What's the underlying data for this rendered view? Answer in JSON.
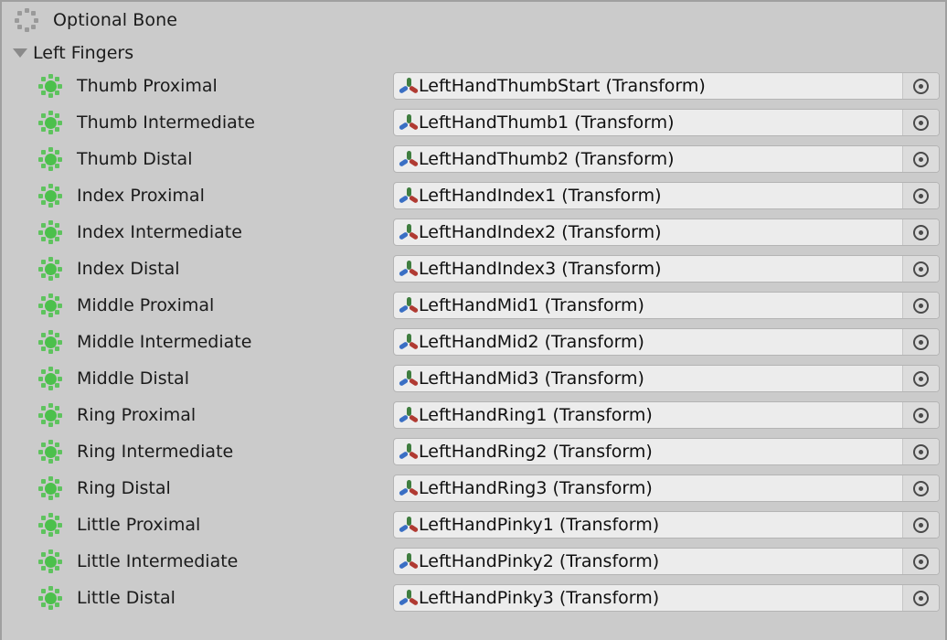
{
  "panel": {
    "legend": {
      "icon": "optional-bone-icon",
      "label": "Optional Bone"
    },
    "group": {
      "icon": "chevron-down-icon",
      "label": "Left Fingers",
      "expanded": true
    },
    "field_icon": "transform-gizmo-icon",
    "picker_icon": "object-picker-icon",
    "bone_icon": "assigned-bone-icon",
    "rows": [
      {
        "label": "Thumb Proximal",
        "value": "LeftHandThumbStart (Transform)"
      },
      {
        "label": "Thumb Intermediate",
        "value": "LeftHandThumb1 (Transform)"
      },
      {
        "label": "Thumb Distal",
        "value": "LeftHandThumb2 (Transform)"
      },
      {
        "label": "Index Proximal",
        "value": "LeftHandIndex1 (Transform)"
      },
      {
        "label": "Index Intermediate",
        "value": "LeftHandIndex2 (Transform)"
      },
      {
        "label": "Index Distal",
        "value": "LeftHandIndex3 (Transform)"
      },
      {
        "label": "Middle Proximal",
        "value": "LeftHandMid1 (Transform)"
      },
      {
        "label": "Middle Intermediate",
        "value": "LeftHandMid2 (Transform)"
      },
      {
        "label": "Middle Distal",
        "value": "LeftHandMid3 (Transform)"
      },
      {
        "label": "Ring Proximal",
        "value": "LeftHandRing1 (Transform)"
      },
      {
        "label": "Ring Intermediate",
        "value": "LeftHandRing2 (Transform)"
      },
      {
        "label": "Ring Distal",
        "value": "LeftHandRing3 (Transform)"
      },
      {
        "label": "Little Proximal",
        "value": "LeftHandPinky1 (Transform)"
      },
      {
        "label": "Little Intermediate",
        "value": "LeftHandPinky2 (Transform)"
      },
      {
        "label": "Little Distal",
        "value": "LeftHandPinky3 (Transform)"
      }
    ]
  },
  "colors": {
    "background": "#cbcbcb",
    "field_background": "#ececec",
    "bone_green": "#4cc04c",
    "axis_green": "#3f7d3f",
    "axis_blue": "#3a6fc4",
    "axis_red": "#b03a32",
    "text": "#1b1b1b"
  }
}
